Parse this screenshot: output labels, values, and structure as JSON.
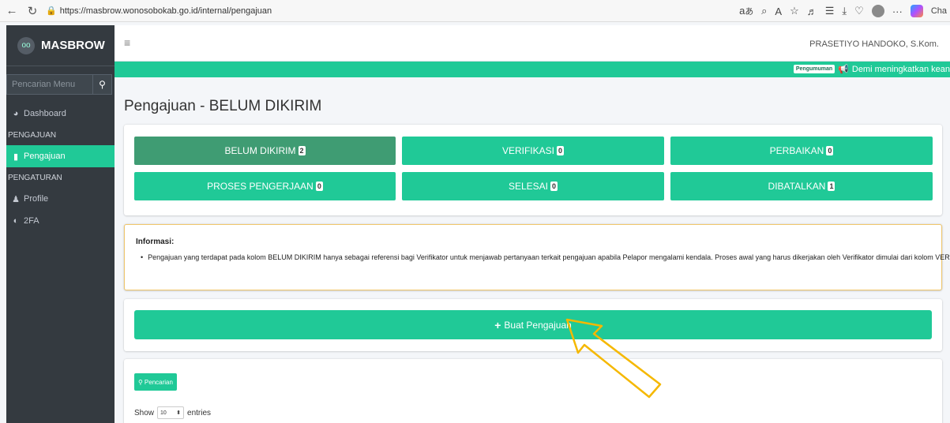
{
  "browser": {
    "url": "https://masbrow.wonosobokab.go.id/internal/pengajuan",
    "tab_partial": "Cha"
  },
  "sidebar": {
    "brand": "MASBROW",
    "search_placeholder": "Pencarian Menu",
    "items": [
      {
        "type": "item",
        "label": "Dashboard",
        "icon": "dashboard-icon"
      },
      {
        "type": "header",
        "label": "PENGAJUAN"
      },
      {
        "type": "item",
        "label": "Pengajuan",
        "icon": "file-icon",
        "active": true
      },
      {
        "type": "header",
        "label": "PENGATURAN"
      },
      {
        "type": "item",
        "label": "Profile",
        "icon": "user-icon"
      },
      {
        "type": "item",
        "label": "2FA",
        "icon": "shield-icon"
      }
    ]
  },
  "header": {
    "user": "PRASETIYO HANDOKO, S.Kom.",
    "announcement_badge": "Pengumuman",
    "announcement_text": "Demi meningkatkan kean"
  },
  "page": {
    "title": "Pengajuan - BELUM DIKIRIM"
  },
  "tabs": [
    {
      "label": "BELUM DIKIRIM",
      "count": "2",
      "active": true
    },
    {
      "label": "VERIFIKASI",
      "count": "0"
    },
    {
      "label": "PERBAIKAN",
      "count": "0"
    },
    {
      "label": "PROSES PENGERJAAN",
      "count": "0"
    },
    {
      "label": "SELESAI",
      "count": "0"
    },
    {
      "label": "DIBATALKAN",
      "count": "1"
    }
  ],
  "info": {
    "title": "Informasi:",
    "text": "Pengajuan yang terdapat pada kolom BELUM DIKIRIM hanya sebagai referensi bagi Verifikator untuk menjawab pertanyaan terkait pengajuan apabila Pelapor mengalami kendala. Proses awal yang harus dikerjakan oleh Verifikator dimulai dari kolom VERIFIKASI."
  },
  "actions": {
    "create_label": "Buat Pengajuan",
    "search_label": "Pencarian"
  },
  "table": {
    "show_label": "Show",
    "page_size": "10",
    "entries_label": "entries"
  },
  "colors": {
    "accent": "#20c997",
    "active_tab": "#3f9c73",
    "sidebar": "#343a40",
    "annotation_arrow": "#f5b800"
  }
}
